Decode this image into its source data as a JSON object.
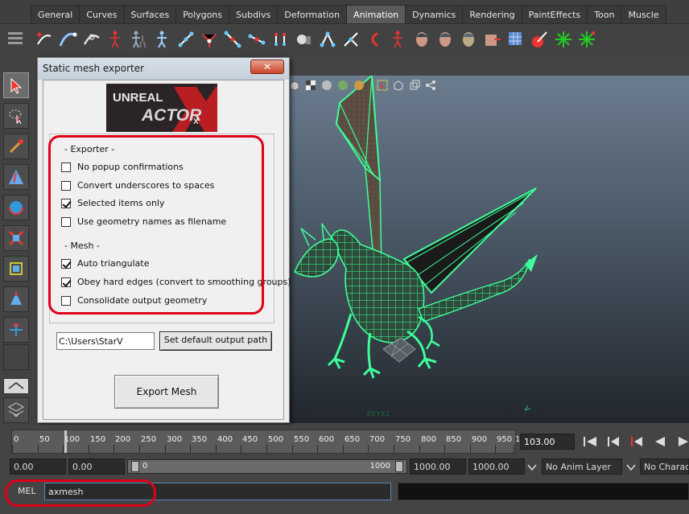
{
  "menu_tabs": [
    "General",
    "Curves",
    "Surfaces",
    "Polygons",
    "Subdivs",
    "Deformation",
    "Animation",
    "Dynamics",
    "Rendering",
    "PaintEffects",
    "Toon",
    "Muscle"
  ],
  "active_tab": "Animation",
  "dialog": {
    "title": "Static mesh exporter",
    "close_glyph": "✕",
    "logo_top": "UNREAL",
    "logo_main": "ACTOR",
    "logo_x": "X",
    "exporter_header": "- Exporter -",
    "mesh_header": "- Mesh -",
    "exporter_options": [
      {
        "label": "No popup confirmations",
        "checked": false
      },
      {
        "label": "Convert underscores to spaces",
        "checked": false
      },
      {
        "label": "Selected items only",
        "checked": true
      },
      {
        "label": "Use geometry names as filename",
        "checked": false
      }
    ],
    "mesh_options": [
      {
        "label": "Auto triangulate",
        "checked": true
      },
      {
        "label": "Obey hard edges (convert to smoothing groups)",
        "checked": true
      },
      {
        "label": "Consolidate output geometry",
        "checked": false
      }
    ],
    "output_path": "C:\\Users\\StarV",
    "set_path_button": "Set default output path",
    "export_button": "Export Mesh"
  },
  "viewport": {
    "coords_text": "DEYXZ"
  },
  "timeline": {
    "ticks": [
      "0",
      "50",
      "100",
      "150",
      "200",
      "250",
      "300",
      "350",
      "400",
      "450",
      "500",
      "550",
      "600",
      "650",
      "700",
      "750",
      "800",
      "850",
      "900",
      "950",
      "1"
    ],
    "current_frame": "103.00"
  },
  "range": {
    "start_time": "0.00",
    "start_range": "0.00",
    "range_min": "0",
    "range_max": "1000",
    "end_range": "1000.00",
    "end_time": "1000.00",
    "anim_layer": "No Anim Layer",
    "character": "No Characte"
  },
  "command_line": {
    "label": "MEL",
    "value": "axmesh"
  },
  "colors": {
    "wireframe": "#3dff9a",
    "highlight_box": "#e0001a",
    "active_tab": "#5a5a5a"
  }
}
